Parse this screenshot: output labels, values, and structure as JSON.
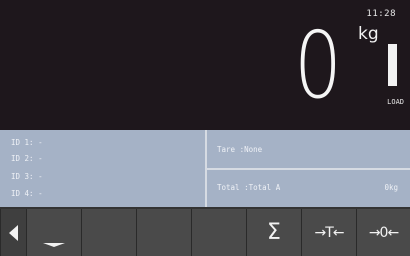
{
  "status": {
    "time": "11:28"
  },
  "weight": {
    "value": "0",
    "unit": "kg",
    "load_label": "LOAD"
  },
  "ids": [
    {
      "label": "ID 1: -"
    },
    {
      "label": "ID 2: -"
    },
    {
      "label": "ID 3: -"
    },
    {
      "label": "ID 4: -"
    }
  ],
  "tare": {
    "label": "Tare  :None"
  },
  "total": {
    "label": "Total :Total A",
    "value": "0kg"
  },
  "softkeys": {
    "sum": "Σ",
    "tare": "→T←",
    "zero": "→0←"
  },
  "colors": {
    "panel": "#a5b2c6",
    "display_bg": "#1e171c",
    "key_bg": "#4a4a4a"
  }
}
